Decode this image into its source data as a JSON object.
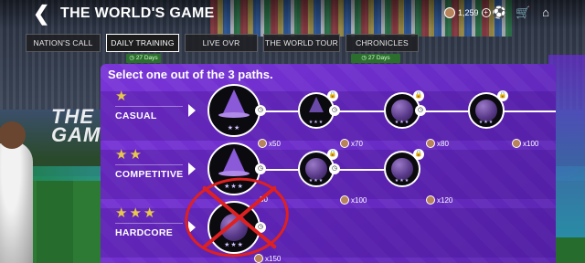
{
  "header": {
    "back_label": "❮",
    "title": "THE WORLD'S GAME",
    "coins": "1,259",
    "plus": "+"
  },
  "tabs": [
    {
      "label": "NATION'S CALL",
      "active": false
    },
    {
      "label": "DAILY TRAINING",
      "active": true,
      "badge": "27 Days"
    },
    {
      "label": "LIVE OVR",
      "active": false
    },
    {
      "label": "THE WORLD TOUR",
      "active": false
    },
    {
      "label": "CHRONICLES",
      "active": false,
      "badge": "27 Days"
    }
  ],
  "background_text": "THE WORLD GAME",
  "panel": {
    "header": "Select one out of the 3 paths.",
    "rows": [
      {
        "stars": "★",
        "label": "CASUAL",
        "rewards": [
          "x50",
          "x70",
          "x80",
          "x100"
        ]
      },
      {
        "stars": "★★",
        "label": "COMPETITIVE",
        "rewards": [
          "80",
          "x100",
          "x120"
        ]
      },
      {
        "stars": "★★★",
        "label": "HARDCORE",
        "rewards": [
          "x150"
        ]
      }
    ]
  },
  "icons": {
    "lock": "🔒",
    "clock": "◷",
    "node_stars_1": "★★",
    "node_stars_3": "★★★"
  },
  "colors": {
    "panel": "#6a2cc8",
    "star": "#e8c84a",
    "badge": "#2b6e2e",
    "annotation": "#e02020"
  }
}
